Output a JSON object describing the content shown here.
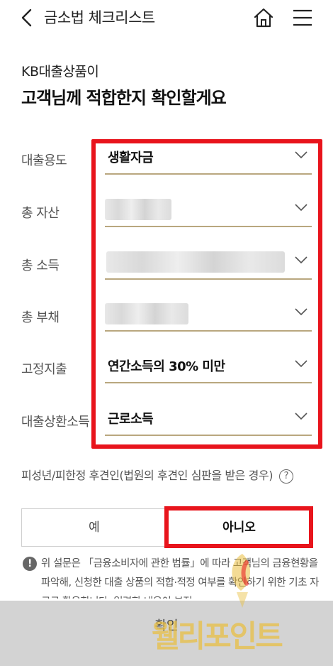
{
  "header": {
    "title": "금소법 체크리스트",
    "back_icon": "chevron-left-icon",
    "home_icon": "home-icon",
    "menu_icon": "hamburger-menu-icon"
  },
  "intro": {
    "product_name": "KB대출상품이",
    "title": "고객님께 적합한지 확인할게요"
  },
  "form": {
    "rows": [
      {
        "label": "대출용도",
        "value": "생활자금"
      },
      {
        "label": "총 자산",
        "value": ""
      },
      {
        "label": "총 소득",
        "value": ""
      },
      {
        "label": "총 부채",
        "value": ""
      },
      {
        "label": "고정지출",
        "value": "연간소득의 30% 미만"
      },
      {
        "label": "대출상환소득",
        "value": "근로소득"
      }
    ]
  },
  "question": {
    "text": "피성년/피한정 후견인(법원의 후견인 심판을 받은 경우)",
    "help_icon": "question-icon",
    "options": {
      "yes": "예",
      "no": "아니오"
    },
    "selected": "no"
  },
  "notice": {
    "icon": "exclamation-icon",
    "text": "위 설문은 「금융소비자에 관한 법률」에 따라 고객님의 금융현황을 파악해, 신청한 대출 상품의 적합·적정 여부를 확인하기 위한 기초 자료로 활용합니다. 입력한 내용이 부정"
  },
  "footer": {
    "confirm_label": "확인"
  },
  "watermark": {
    "text": "웰리포인트"
  },
  "colors": {
    "highlight_red": "#e8141c",
    "underline_gold": "#b9a77f",
    "watermark_yellow": "#e9be3e"
  }
}
